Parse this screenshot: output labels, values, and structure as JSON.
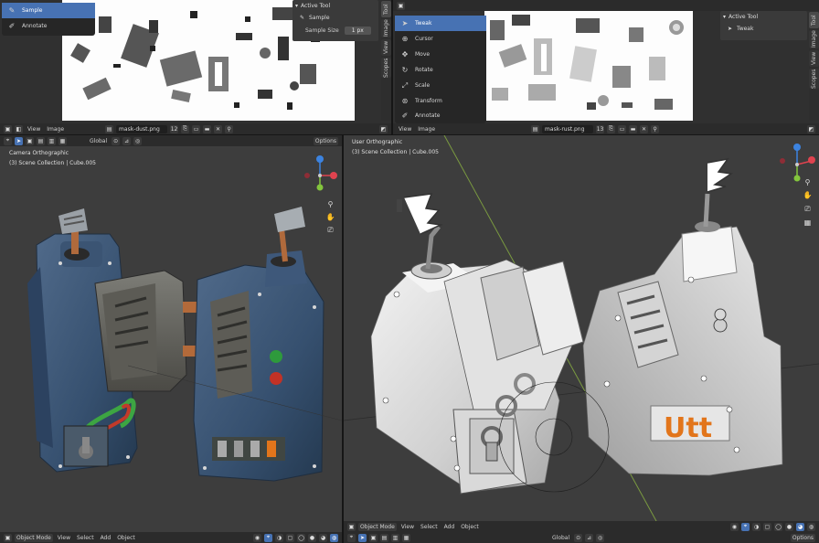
{
  "top_left": {
    "toolbar": [
      {
        "label": "Sample",
        "icon": "eyedropper-icon",
        "active": true
      },
      {
        "label": "Annotate",
        "icon": "annotate-icon",
        "active": false
      }
    ],
    "npanel": {
      "header": "Active Tool",
      "tool_name": "Sample",
      "sample_size_label": "Sample Size",
      "sample_size_value": "1 px"
    },
    "side_tabs": [
      "Tool",
      "Image",
      "View",
      "Scopes"
    ],
    "header": {
      "view": "View",
      "image": "Image",
      "filename": "mask-dust.png",
      "user_count": "12"
    }
  },
  "top_right": {
    "toolbar": [
      {
        "label": "Tweak",
        "icon": "cursor-icon",
        "active": true
      },
      {
        "label": "Cursor",
        "icon": "3d-cursor-icon",
        "active": false
      },
      {
        "label": "Move",
        "icon": "move-icon",
        "active": false
      },
      {
        "label": "Rotate",
        "icon": "rotate-icon",
        "active": false
      },
      {
        "label": "Scale",
        "icon": "scale-icon",
        "active": false
      },
      {
        "label": "Transform",
        "icon": "transform-icon",
        "active": false
      },
      {
        "label": "Annotate",
        "icon": "annotate-icon",
        "active": false
      }
    ],
    "npanel": {
      "header": "Active Tool",
      "tool_name": "Tweak"
    },
    "side_tabs": [
      "Tool",
      "Image",
      "View",
      "Scopes"
    ],
    "header": {
      "view": "View",
      "image": "Image",
      "filename": "mask-rust.png",
      "user_count": "13"
    }
  },
  "bottom_left": {
    "header": {
      "transform_orientation": "Global",
      "options": "Options"
    },
    "info_line1": "Camera Orthographic",
    "info_line2": "(3) Scene Collection | Cube.005",
    "footer": {
      "mode": "Object Mode",
      "view": "View",
      "select": "Select",
      "add": "Add",
      "object": "Object"
    }
  },
  "bottom_right": {
    "info_line1": "User Orthographic",
    "info_line2": "(3) Scene Collection | Cube.005",
    "footer": {
      "mode": "Object Mode",
      "view": "View",
      "select": "Select",
      "add": "Add",
      "object": "Object",
      "transform_orientation": "Global",
      "options": "Options"
    }
  },
  "decal_text": "Utt",
  "colors": {
    "accent": "#4772b3",
    "axis_x": "#e0434f",
    "axis_y": "#83c53d",
    "axis_z": "#3c83e0",
    "rust_blue": "#3d5572",
    "decal_orange": "#e2751b"
  }
}
